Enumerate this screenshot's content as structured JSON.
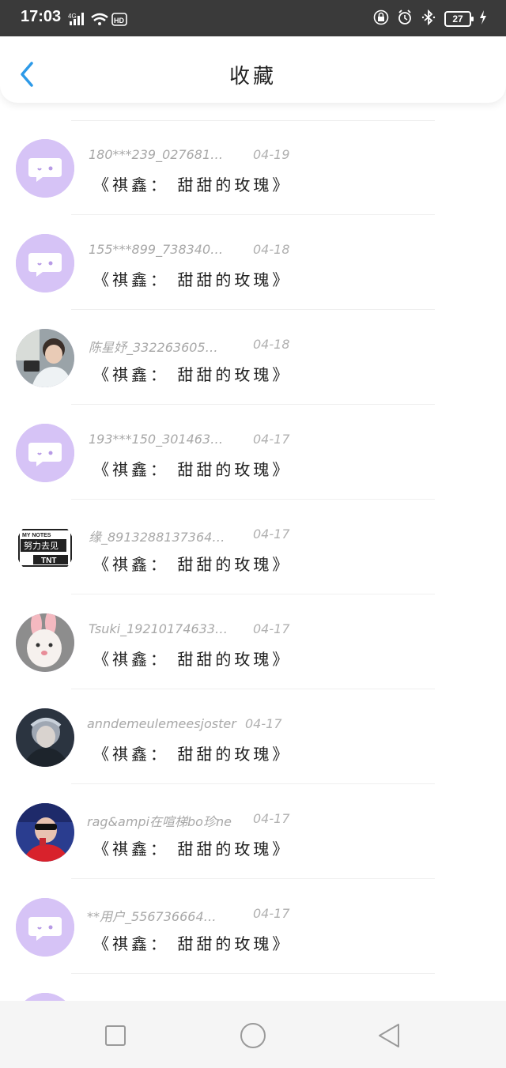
{
  "status_bar": {
    "time": "17:03",
    "network": "4G",
    "hd": "HD",
    "battery": "27"
  },
  "header": {
    "title": "收藏",
    "back_icon": "chevron-left-icon",
    "accent": "#2d9ae8"
  },
  "favorites": [
    {
      "user": "180***239_027681…",
      "date": "04-19",
      "song": "《祺鑫： 甜甜的玫瑰》",
      "avatar": "default-chat-avatar"
    },
    {
      "user": "155***899_738340…",
      "date": "04-18",
      "song": "《祺鑫： 甜甜的玫瑰》",
      "avatar": "default-chat-avatar"
    },
    {
      "user": "陈星妤_332263605…",
      "date": "04-18",
      "song": "《祺鑫： 甜甜的玫瑰》",
      "avatar": "photo-avatar"
    },
    {
      "user": "193***150_301463…",
      "date": "04-17",
      "song": "《祺鑫： 甜甜的玫瑰》",
      "avatar": "default-chat-avatar"
    },
    {
      "user": "缘_8913288137364…",
      "date": "04-17",
      "song": "《祺鑫： 甜甜的玫瑰》",
      "avatar": "text-avatar"
    },
    {
      "user": "Tsuki_19210174633…",
      "date": "04-17",
      "song": "《祺鑫： 甜甜的玫瑰》",
      "avatar": "cartoon-avatar"
    },
    {
      "user": "anndemeulemeesjoster",
      "date": "04-17",
      "song": "《祺鑫： 甜甜的玫瑰》",
      "avatar": "photo-avatar"
    },
    {
      "user": "rag&ampi在喧梯bo珍ne",
      "date": "04-17",
      "song": "《祺鑫： 甜甜的玫瑰》",
      "avatar": "photo-avatar"
    },
    {
      "user": "**用户_556736664…",
      "date": "04-17",
      "song": "《祺鑫： 甜甜的玫瑰》",
      "avatar": "default-chat-avatar"
    }
  ],
  "avatar_text": {
    "line1": "MY NOTES",
    "line2": "努力去见",
    "line3": "TNT"
  },
  "nav": {
    "recents_icon": "square-icon",
    "home_icon": "circle-icon",
    "back_icon": "triangle-back-icon"
  }
}
